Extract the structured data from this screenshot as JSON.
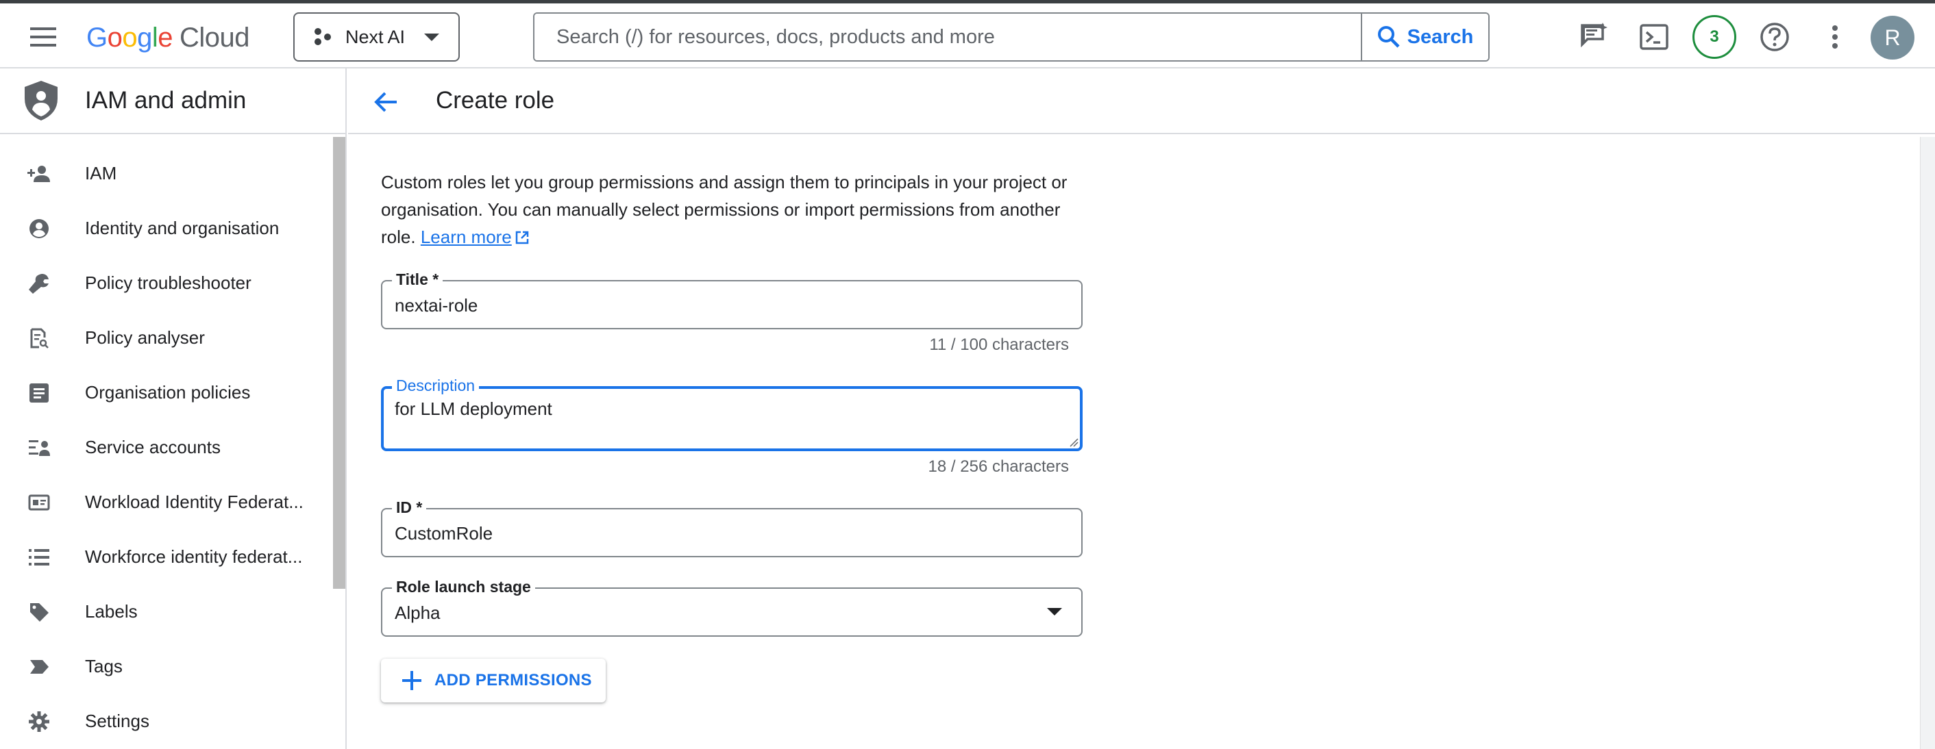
{
  "header": {
    "logo_letters": [
      "G",
      "o",
      "o",
      "g",
      "l",
      "e"
    ],
    "logo_cloud": "Cloud",
    "project": "Next AI",
    "search_placeholder": "Search (/) for resources, docs, products and more",
    "search_button": "Search",
    "notifications_count": "3",
    "avatar_initial": "R"
  },
  "sidebar": {
    "title": "IAM and admin",
    "items": [
      {
        "label": "IAM",
        "icon": "person-add-icon"
      },
      {
        "label": "Identity and organisation",
        "icon": "account-circle-icon"
      },
      {
        "label": "Policy troubleshooter",
        "icon": "wrench-icon"
      },
      {
        "label": "Policy analyser",
        "icon": "policy-document-icon"
      },
      {
        "label": "Organisation policies",
        "icon": "article-icon"
      },
      {
        "label": "Service accounts",
        "icon": "service-account-icon"
      },
      {
        "label": "Workload Identity Federat...",
        "icon": "id-card-icon"
      },
      {
        "label": "Workforce identity federat...",
        "icon": "list-icon"
      },
      {
        "label": "Labels",
        "icon": "label-icon"
      },
      {
        "label": "Tags",
        "icon": "tag-icon"
      },
      {
        "label": "Settings",
        "icon": "gear-icon"
      }
    ]
  },
  "page": {
    "title": "Create role",
    "intro_line1": "Custom roles let you group permissions and assign them to principals in your project or",
    "intro_line2": "organisation. You can manually select permissions or import permissions from another",
    "intro_line3_prefix": "role.",
    "learn_more": "Learn more"
  },
  "form": {
    "title_label": "Title *",
    "title_value": "nextai-role",
    "title_counter": "11 / 100 characters",
    "description_label": "Description",
    "description_value": "for LLM deployment",
    "description_counter": "18 / 256 characters",
    "id_label": "ID *",
    "id_value": "CustomRole",
    "stage_label": "Role launch stage",
    "stage_value": "Alpha",
    "add_permissions": "ADD PERMISSIONS"
  },
  "colors": {
    "accent": "#1a73e8",
    "notification_ring": "#1e8e3e",
    "avatar_bg": "#78909c"
  }
}
